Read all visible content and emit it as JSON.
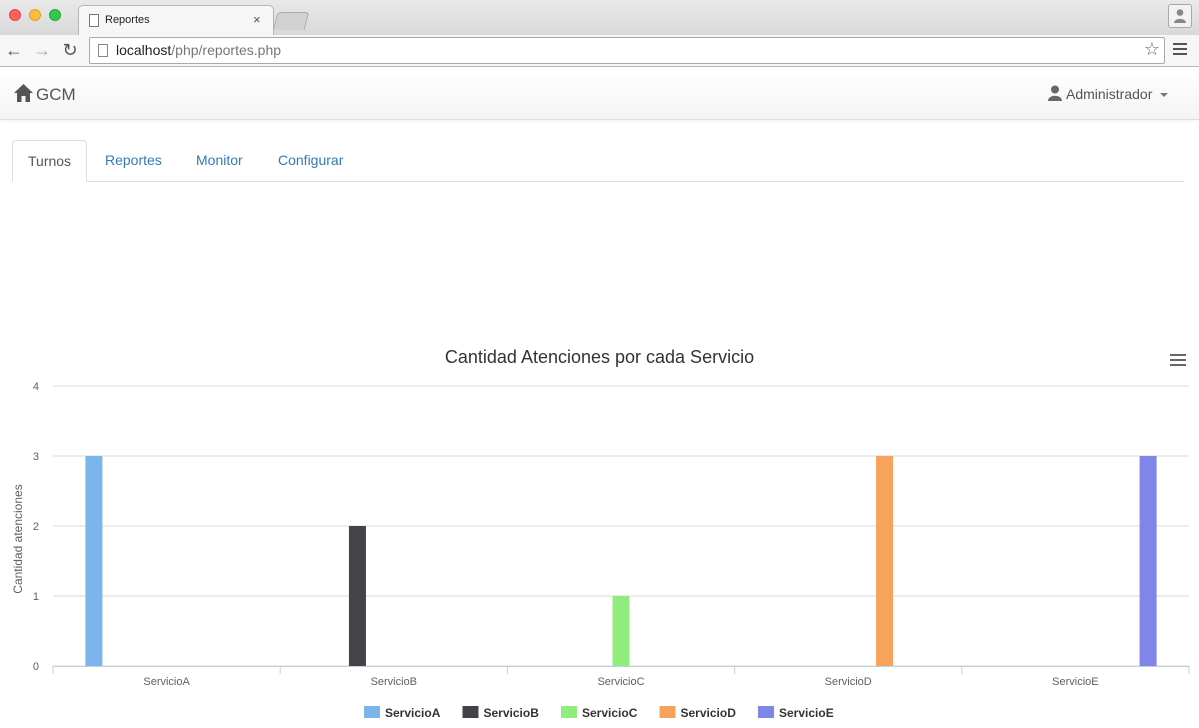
{
  "browser": {
    "tab_title": "Reportes",
    "tab_close": "×",
    "url_host": "localhost",
    "url_path": "/php/reportes.php",
    "bookmark_icon": "star-icon"
  },
  "navbar": {
    "brand": "GCM",
    "brand_icon": "home-icon",
    "user": "Administrador",
    "user_icon": "user-icon"
  },
  "tabs": [
    {
      "label": "Turnos",
      "active": true
    },
    {
      "label": "Reportes",
      "active": false
    },
    {
      "label": "Monitor",
      "active": false
    },
    {
      "label": "Configurar",
      "active": false
    }
  ],
  "chart_data": {
    "type": "bar",
    "title": "Cantidad Atenciones por cada Servicio",
    "xlabel": "",
    "ylabel": "Cantidad atenciones",
    "ylim": [
      0,
      4
    ],
    "yticks": [
      "0",
      "1",
      "2",
      "3",
      "4"
    ],
    "categories": [
      "ServicioA",
      "ServicioB",
      "ServicioC",
      "ServicioD",
      "ServicioE"
    ],
    "grid": true,
    "legend_position": "bottom",
    "series": [
      {
        "name": "ServicioA",
        "color": "#7cb5ec",
        "values": [
          3,
          null,
          null,
          null,
          null
        ]
      },
      {
        "name": "ServicioB",
        "color": "#434348",
        "values": [
          null,
          2,
          null,
          null,
          null
        ]
      },
      {
        "name": "ServicioC",
        "color": "#90ed7d",
        "values": [
          null,
          null,
          1,
          null,
          null
        ]
      },
      {
        "name": "ServicioD",
        "color": "#f7a35c",
        "values": [
          null,
          null,
          null,
          3,
          null
        ]
      },
      {
        "name": "ServicioE",
        "color": "#8085e9",
        "values": [
          null,
          null,
          null,
          null,
          3
        ]
      }
    ]
  }
}
